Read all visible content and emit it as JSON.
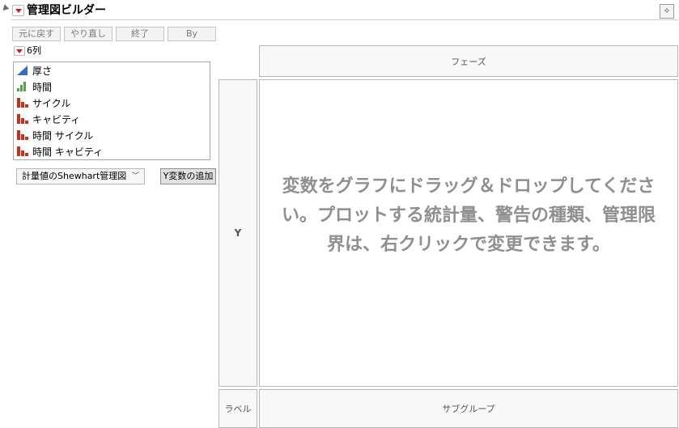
{
  "title": "管理図ビルダー",
  "toolbar": {
    "undo": "元に戻す",
    "redo": "やり直し",
    "finish": "終了",
    "by": "By"
  },
  "columns": {
    "header": "6列",
    "items": [
      {
        "label": "厚さ",
        "icon": "continuous-icon"
      },
      {
        "label": "時間",
        "icon": "ordinal-icon"
      },
      {
        "label": "サイクル",
        "icon": "nominal-icon"
      },
      {
        "label": "キャビティ",
        "icon": "nominal-icon"
      },
      {
        "label": "時間 サイクル",
        "icon": "nominal-icon"
      },
      {
        "label": "時間 キャビティ",
        "icon": "nominal-icon"
      }
    ]
  },
  "chart_type": {
    "selected": "計量値のShewhart管理図"
  },
  "add_y_button": "Y変数の追加",
  "zones": {
    "phase": "フェーズ",
    "y": "Y",
    "label": "ラベル",
    "subgroup": "サブグループ"
  },
  "graph": {
    "instructions": "変数をグラフにドラッグ＆ドロップしてください。プロットする統計量、警告の種類、管理限界は、右クリックで変更できます。"
  },
  "colors": {
    "menu_red": "#d01c1c",
    "continuous_blue": "#3a6bc2",
    "ordinal_green": "#56a24a",
    "nominal_red": "#c3321b",
    "instruction_gray": "#8f8f8f"
  }
}
